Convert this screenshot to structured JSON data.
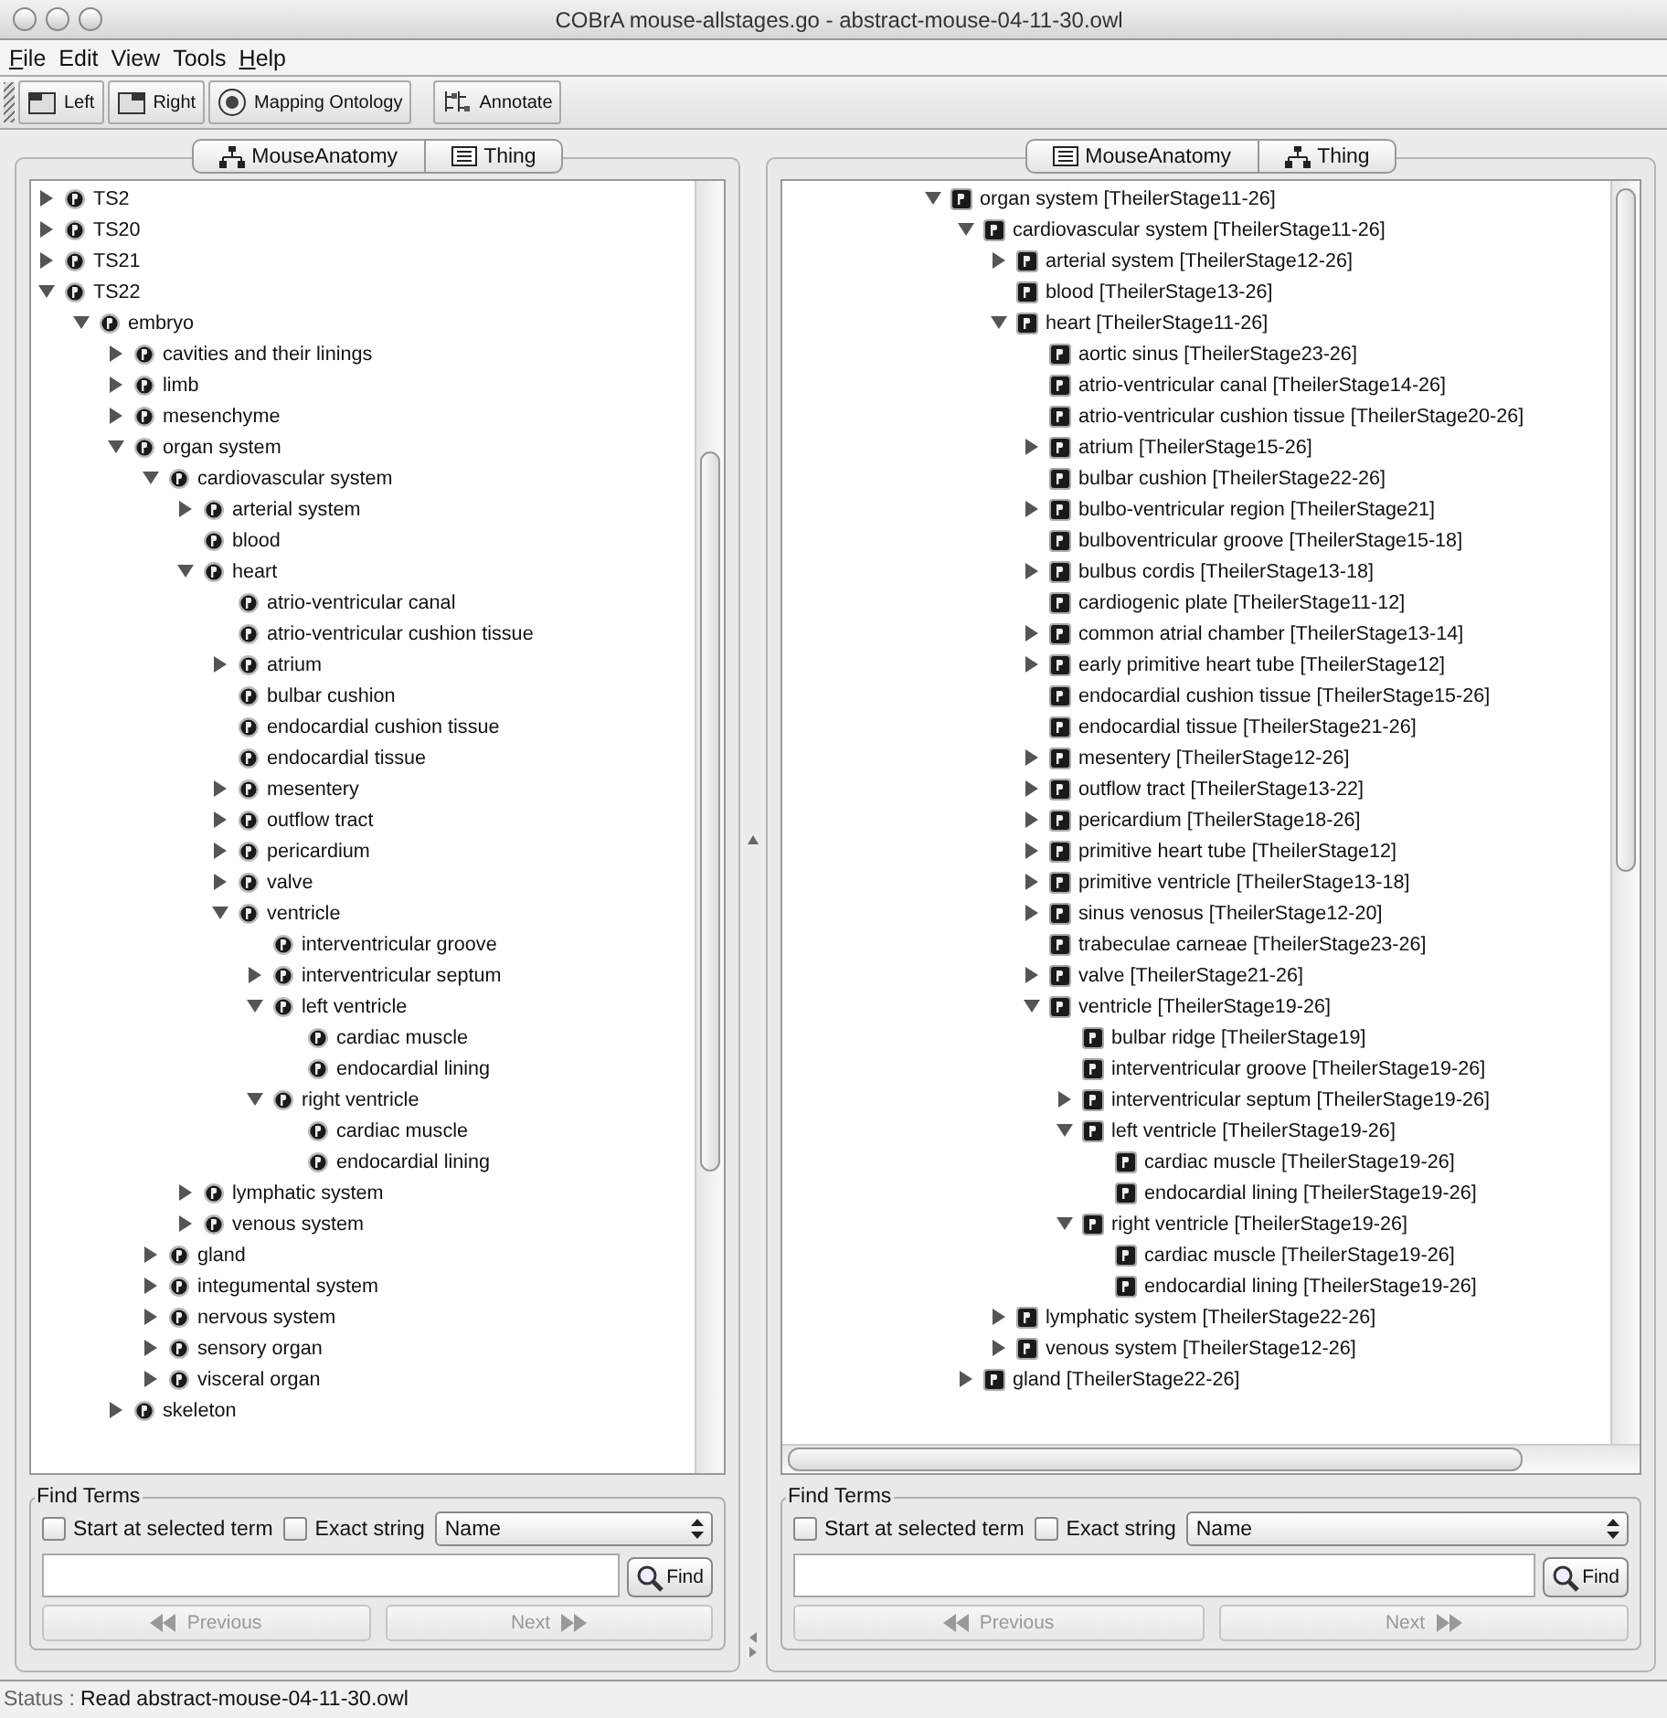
{
  "window": {
    "title": "COBrA  mouse-allstages.go - abstract-mouse-04-11-30.owl"
  },
  "menu": [
    {
      "label": "File",
      "mnemonic": true
    },
    {
      "label": "Edit",
      "mnemonic": false
    },
    {
      "label": "View",
      "mnemonic": false
    },
    {
      "label": "Tools",
      "mnemonic": false
    },
    {
      "label": "Help",
      "mnemonic": true
    }
  ],
  "toolbar": [
    {
      "label": "Left",
      "kind": "left"
    },
    {
      "label": "Right",
      "kind": "right"
    },
    {
      "label": "Mapping Ontology",
      "kind": "mapping"
    },
    {
      "label": "Annotate",
      "kind": "annotate"
    }
  ],
  "panels": [
    {
      "tabs": [
        {
          "label": "MouseAnatomy",
          "kind": "hierarchy"
        },
        {
          "label": "Thing",
          "kind": "list"
        }
      ],
      "tree": [
        {
          "label": "TS2",
          "kind": "branch",
          "expanded": false
        },
        {
          "label": "TS20",
          "kind": "branch",
          "expanded": false
        },
        {
          "label": "TS21",
          "kind": "branch",
          "expanded": false
        },
        {
          "label": "TS22",
          "kind": "branch",
          "expanded": true,
          "children": [
            {
              "label": "embryo",
              "kind": "branch",
              "expanded": true,
              "children": [
                {
                  "label": "cavities and their linings",
                  "kind": "branch",
                  "expanded": false
                },
                {
                  "label": "limb",
                  "kind": "branch",
                  "expanded": false
                },
                {
                  "label": "mesenchyme",
                  "kind": "branch",
                  "expanded": false
                },
                {
                  "label": "organ system",
                  "kind": "branch",
                  "expanded": true,
                  "children": [
                    {
                      "label": "cardiovascular system",
                      "kind": "branch",
                      "expanded": true,
                      "children": [
                        {
                          "label": "arterial system",
                          "kind": "branch",
                          "expanded": false
                        },
                        {
                          "label": "blood",
                          "kind": "leaf"
                        },
                        {
                          "label": "heart",
                          "kind": "branch",
                          "expanded": true,
                          "children": [
                            {
                              "label": "atrio-ventricular canal",
                              "kind": "leaf"
                            },
                            {
                              "label": "atrio-ventricular cushion tissue",
                              "kind": "leaf"
                            },
                            {
                              "label": "atrium",
                              "kind": "branch",
                              "expanded": false
                            },
                            {
                              "label": "bulbar cushion",
                              "kind": "leaf"
                            },
                            {
                              "label": "endocardial cushion tissue",
                              "kind": "leaf"
                            },
                            {
                              "label": "endocardial tissue",
                              "kind": "leaf"
                            },
                            {
                              "label": "mesentery",
                              "kind": "branch",
                              "expanded": false
                            },
                            {
                              "label": "outflow tract",
                              "kind": "branch",
                              "expanded": false
                            },
                            {
                              "label": "pericardium",
                              "kind": "branch",
                              "expanded": false
                            },
                            {
                              "label": "valve",
                              "kind": "branch",
                              "expanded": false
                            },
                            {
                              "label": "ventricle",
                              "kind": "branch",
                              "expanded": true,
                              "children": [
                                {
                                  "label": "interventricular groove",
                                  "kind": "leaf"
                                },
                                {
                                  "label": "interventricular septum",
                                  "kind": "branch",
                                  "expanded": false
                                },
                                {
                                  "label": "left ventricle",
                                  "kind": "branch",
                                  "expanded": true,
                                  "children": [
                                    {
                                      "label": "cardiac muscle",
                                      "kind": "leaf"
                                    },
                                    {
                                      "label": "endocardial lining",
                                      "kind": "leaf"
                                    }
                                  ]
                                },
                                {
                                  "label": "right ventricle",
                                  "kind": "branch",
                                  "expanded": true,
                                  "children": [
                                    {
                                      "label": "cardiac muscle",
                                      "kind": "leaf"
                                    },
                                    {
                                      "label": "endocardial lining",
                                      "kind": "leaf"
                                    }
                                  ]
                                }
                              ]
                            }
                          ]
                        },
                        {
                          "label": "lymphatic system",
                          "kind": "branch",
                          "expanded": false
                        },
                        {
                          "label": "venous system",
                          "kind": "branch",
                          "expanded": false
                        }
                      ]
                    },
                    {
                      "label": "gland",
                      "kind": "branch",
                      "expanded": false
                    },
                    {
                      "label": "integumental system",
                      "kind": "branch",
                      "expanded": false
                    },
                    {
                      "label": "nervous system",
                      "kind": "branch",
                      "expanded": false
                    },
                    {
                      "label": "sensory organ",
                      "kind": "branch",
                      "expanded": false
                    },
                    {
                      "label": "visceral organ",
                      "kind": "branch",
                      "expanded": false
                    }
                  ]
                },
                {
                  "label": "skeleton",
                  "kind": "branch",
                  "expanded": false
                }
              ]
            }
          ]
        }
      ],
      "find": {
        "title": "Find Terms",
        "options": [
          {
            "label": "Start at selected term",
            "checked": false
          },
          {
            "label": "Exact string",
            "checked": false
          }
        ],
        "field": "Name",
        "find_button": "Find",
        "previous": {
          "label": "Previous",
          "disabled": true
        },
        "next": {
          "label": "Next",
          "disabled": true
        }
      }
    },
    {
      "tabs": [
        {
          "label": "MouseAnatomy",
          "kind": "list"
        },
        {
          "label": "Thing",
          "kind": "hierarchy"
        }
      ],
      "tree": [
        {
          "label": "organ system [TheilerStage11-26]",
          "kind": "branch",
          "expanded": true,
          "children": [
            {
              "label": "cardiovascular system [TheilerStage11-26]",
              "kind": "branch",
              "expanded": true,
              "children": [
                {
                  "label": "arterial system [TheilerStage12-26]",
                  "kind": "branch",
                  "expanded": false
                },
                {
                  "label": "blood [TheilerStage13-26]",
                  "kind": "leaf"
                },
                {
                  "label": "heart [TheilerStage11-26]",
                  "kind": "branch",
                  "expanded": true,
                  "children": [
                    {
                      "label": "aortic sinus [TheilerStage23-26]",
                      "kind": "leaf"
                    },
                    {
                      "label": "atrio-ventricular canal [TheilerStage14-26]",
                      "kind": "leaf"
                    },
                    {
                      "label": "atrio-ventricular cushion tissue [TheilerStage20-26]",
                      "kind": "leaf"
                    },
                    {
                      "label": "atrium [TheilerStage15-26]",
                      "kind": "branch",
                      "expanded": false
                    },
                    {
                      "label": "bulbar cushion [TheilerStage22-26]",
                      "kind": "leaf"
                    },
                    {
                      "label": "bulbo-ventricular region [TheilerStage21]",
                      "kind": "branch",
                      "expanded": false
                    },
                    {
                      "label": "bulboventricular groove [TheilerStage15-18]",
                      "kind": "leaf"
                    },
                    {
                      "label": "bulbus cordis [TheilerStage13-18]",
                      "kind": "branch",
                      "expanded": false
                    },
                    {
                      "label": "cardiogenic plate [TheilerStage11-12]",
                      "kind": "leaf"
                    },
                    {
                      "label": "common atrial chamber [TheilerStage13-14]",
                      "kind": "branch",
                      "expanded": false
                    },
                    {
                      "label": "early primitive heart tube [TheilerStage12]",
                      "kind": "branch",
                      "expanded": false
                    },
                    {
                      "label": "endocardial cushion tissue [TheilerStage15-26]",
                      "kind": "leaf"
                    },
                    {
                      "label": "endocardial tissue [TheilerStage21-26]",
                      "kind": "leaf"
                    },
                    {
                      "label": "mesentery [TheilerStage12-26]",
                      "kind": "branch",
                      "expanded": false
                    },
                    {
                      "label": "outflow tract [TheilerStage13-22]",
                      "kind": "branch",
                      "expanded": false
                    },
                    {
                      "label": "pericardium [TheilerStage18-26]",
                      "kind": "branch",
                      "expanded": false
                    },
                    {
                      "label": "primitive heart tube [TheilerStage12]",
                      "kind": "branch",
                      "expanded": false
                    },
                    {
                      "label": "primitive ventricle [TheilerStage13-18]",
                      "kind": "branch",
                      "expanded": false
                    },
                    {
                      "label": "sinus venosus [TheilerStage12-20]",
                      "kind": "branch",
                      "expanded": false
                    },
                    {
                      "label": "trabeculae carneae [TheilerStage23-26]",
                      "kind": "leaf"
                    },
                    {
                      "label": "valve [TheilerStage21-26]",
                      "kind": "branch",
                      "expanded": false
                    },
                    {
                      "label": "ventricle [TheilerStage19-26]",
                      "kind": "branch",
                      "expanded": true,
                      "children": [
                        {
                          "label": "bulbar ridge [TheilerStage19]",
                          "kind": "leaf"
                        },
                        {
                          "label": "interventricular groove [TheilerStage19-26]",
                          "kind": "leaf"
                        },
                        {
                          "label": "interventricular septum [TheilerStage19-26]",
                          "kind": "branch",
                          "expanded": false
                        },
                        {
                          "label": "left ventricle [TheilerStage19-26]",
                          "kind": "branch",
                          "expanded": true,
                          "children": [
                            {
                              "label": "cardiac muscle [TheilerStage19-26]",
                              "kind": "leaf"
                            },
                            {
                              "label": "endocardial lining [TheilerStage19-26]",
                              "kind": "leaf"
                            }
                          ]
                        },
                        {
                          "label": "right ventricle [TheilerStage19-26]",
                          "kind": "branch",
                          "expanded": true,
                          "children": [
                            {
                              "label": "cardiac muscle [TheilerStage19-26]",
                              "kind": "leaf"
                            },
                            {
                              "label": "endocardial lining [TheilerStage19-26]",
                              "kind": "leaf"
                            }
                          ]
                        }
                      ]
                    }
                  ]
                },
                {
                  "label": "lymphatic system [TheilerStage22-26]",
                  "kind": "branch",
                  "expanded": false
                },
                {
                  "label": "venous system [TheilerStage12-26]",
                  "kind": "branch",
                  "expanded": false
                }
              ]
            },
            {
              "label": "gland [TheilerStage22-26]",
              "kind": "branch",
              "expanded": false
            }
          ]
        }
      ],
      "find": {
        "title": "Find Terms",
        "options": [
          {
            "label": "Start at selected term",
            "checked": false
          },
          {
            "label": "Exact string",
            "checked": false
          }
        ],
        "field": "Name",
        "find_button": "Find",
        "previous": {
          "label": "Previous",
          "disabled": true
        },
        "next": {
          "label": "Next",
          "disabled": true
        }
      }
    }
  ],
  "status": {
    "label": "Status :",
    "message": "Read abstract-mouse-04-11-30.owl"
  }
}
